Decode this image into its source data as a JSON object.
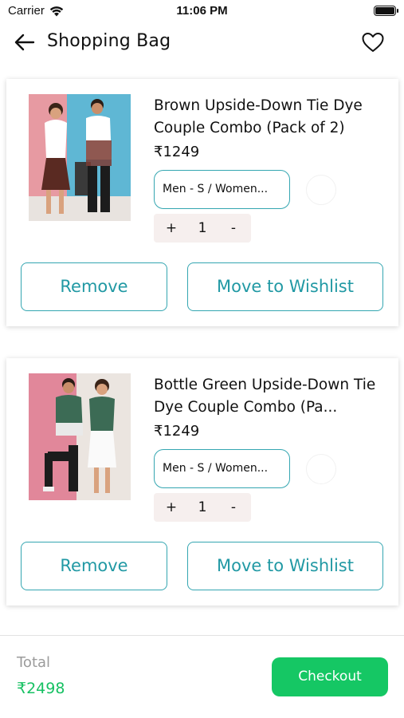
{
  "status_bar": {
    "carrier": "Carrier",
    "time": "11:06 PM"
  },
  "header": {
    "title": "Shopping Bag",
    "back_icon": "arrow-left-icon",
    "wishlist_icon": "heart-icon"
  },
  "cart_items": [
    {
      "name": "Brown Upside-Down Tie Dye Couple Combo (Pack of 2)",
      "price": "₹1249",
      "variant": "Men - S / Women...",
      "quantity": "1",
      "increment_label": "+",
      "decrement_label": "-",
      "remove_label": "Remove",
      "wishlist_label": "Move to Wishlist"
    },
    {
      "name": "Bottle Green Upside-Down Tie Dye Couple Combo (Pa...",
      "price": "₹1249",
      "variant": "Men - S / Women...",
      "quantity": "1",
      "increment_label": "+",
      "decrement_label": "-",
      "remove_label": "Remove",
      "wishlist_label": "Move to Wishlist"
    }
  ],
  "footer": {
    "total_label": "Total",
    "total_value": "₹2498",
    "checkout_label": "Checkout"
  },
  "colors": {
    "accent": "#34a6b1",
    "accent_text": "#2199a4",
    "checkout": "#15c764",
    "total": "#17c163",
    "stepper_bg": "#f6efee"
  }
}
